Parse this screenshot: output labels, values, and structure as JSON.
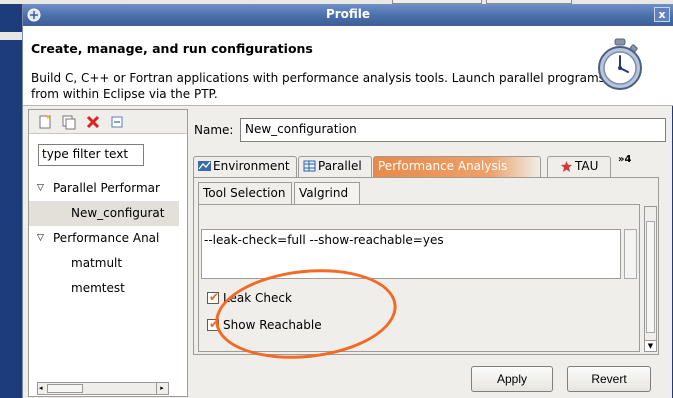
{
  "window": {
    "title": "Profile",
    "close_label": "x"
  },
  "background": {
    "buttons": [
      "Apply",
      "Revert"
    ]
  },
  "header": {
    "title": "Create, manage, and run configurations",
    "description": "Build C, C++ or Fortran applications with performance analysis tools.  Launch parallel programs from within Eclipse via the PTP.",
    "icon": "stopwatch-icon"
  },
  "left_panel": {
    "toolbar_icons": [
      "new-config-icon",
      "duplicate-icon",
      "delete-icon",
      "collapse-all-icon"
    ],
    "filter_placeholder": "type filter text",
    "tree": [
      {
        "label": "Parallel Performar",
        "level": 0,
        "expanded": true
      },
      {
        "label": "New_configurat",
        "level": 1,
        "selected": true
      },
      {
        "label": "Performance Anal",
        "level": 0,
        "expanded": true
      },
      {
        "label": "matmult",
        "level": 1
      },
      {
        "label": "memtest",
        "level": 1
      }
    ]
  },
  "config": {
    "name_label": "Name:",
    "name_value": "New_configuration",
    "tabs": [
      {
        "label": "Environment",
        "icon": "environment-icon"
      },
      {
        "label": "Parallel",
        "icon": "parallel-icon"
      },
      {
        "label": "Performance Analysis",
        "active": true
      },
      {
        "label": "TAU",
        "icon": "tau-icon"
      }
    ],
    "more_tabs": "»4",
    "subtabs": [
      {
        "label": "Tool Selection"
      },
      {
        "label": "Valgrind",
        "active": true
      }
    ],
    "arguments": "--leak-check=full  --show-reachable=yes",
    "checkboxes": [
      {
        "label": "Leak Check",
        "checked": true
      },
      {
        "label": "Show Reachable",
        "checked": true
      }
    ]
  },
  "buttons": {
    "apply": "Apply",
    "revert": "Revert"
  },
  "colors": {
    "title_bar": "#4a6ea8",
    "active_tab": "#e88a4a",
    "annotation": "#f26a24"
  }
}
